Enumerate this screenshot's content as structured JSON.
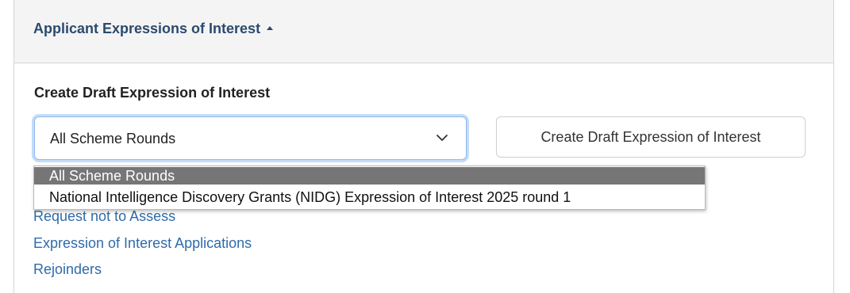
{
  "panel": {
    "title": "Applicant Expressions of Interest",
    "toggle_icon": "caret-up-icon"
  },
  "create_section": {
    "label": "Create Draft Expression of Interest",
    "select": {
      "selected_value": "All Scheme Rounds",
      "icon": "chevron-down-icon",
      "options": [
        "All Scheme Rounds",
        "National Intelligence Discovery Grants (NIDG) Expression of Interest 2025 round 1"
      ]
    },
    "button_label": "Create Draft Expression of Interest"
  },
  "links": [
    "Request not to Assess",
    "Expression of Interest Applications",
    "Rejoinders"
  ],
  "colors": {
    "title_text": "#2b4a6e",
    "link": "#2f6bab",
    "selected_option_bg": "#767676",
    "focus_ring": "#c5dcf9"
  }
}
